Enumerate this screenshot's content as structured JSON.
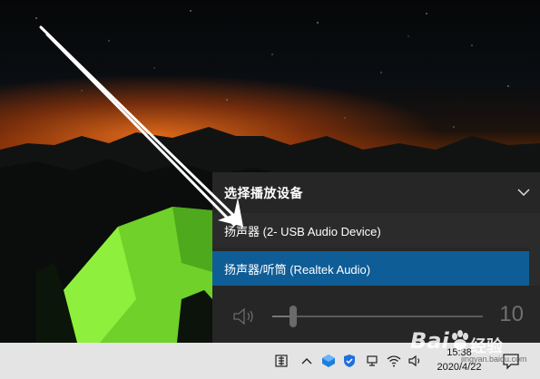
{
  "flyout": {
    "title": "选择播放设备",
    "devices": [
      {
        "label": "扬声器 (2- USB Audio Device)",
        "selected": false
      },
      {
        "label": "扬声器/听筒 (Realtek Audio)",
        "selected": true
      }
    ],
    "volume": {
      "value_label": "10",
      "level_percent": 10
    },
    "colors": {
      "background": "#282828",
      "selected": "#0f5d96",
      "text": "#ffffff"
    }
  },
  "taskbar": {
    "clock": {
      "time": "15:38",
      "date": "2020/4/22"
    },
    "icons": [
      "input-method-icon",
      "chevron-up-icon",
      "cube-icon",
      "shield-icon",
      "network-device-icon",
      "wifi-icon",
      "speaker-icon",
      "notification-icon"
    ],
    "color": "#e4e4e4"
  },
  "watermark": {
    "brand": "Bai",
    "brand_suffix": "经验",
    "url": "jingyan.baidu.com"
  }
}
